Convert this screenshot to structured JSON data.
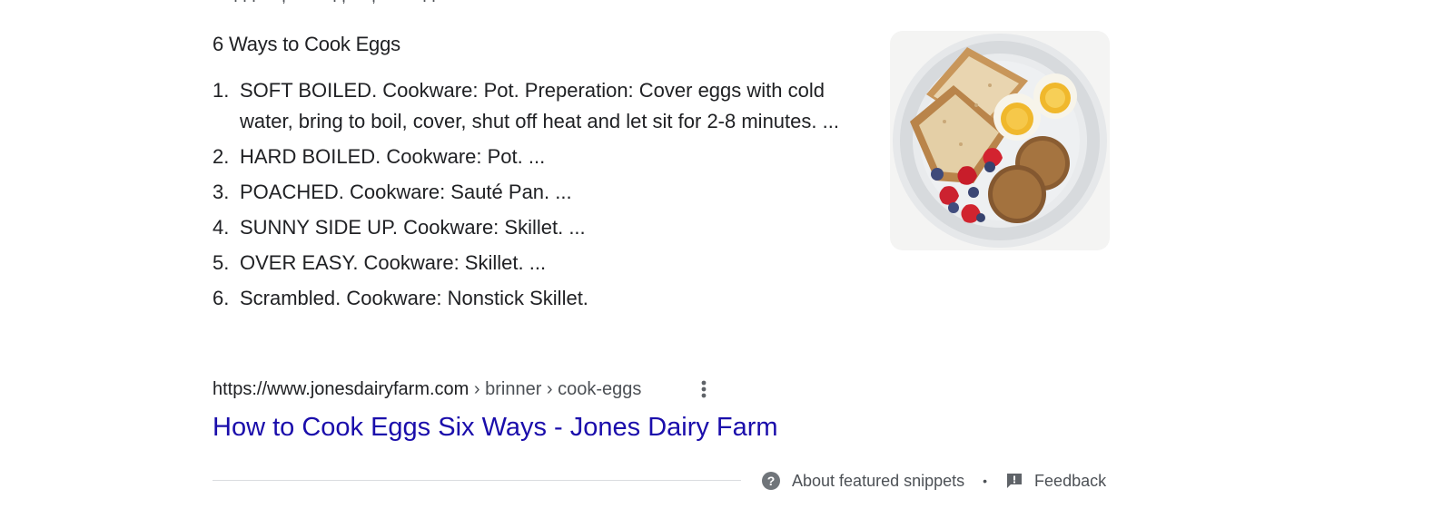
{
  "previous_result": {
    "cutoff_text": "— . . . — , — — . , — , — — . . —"
  },
  "featured_snippet": {
    "title": "6 Ways to Cook Eggs",
    "items": [
      {
        "num": "1.",
        "text": "SOFT BOILED. Cookware: Pot. Preperation: Cover eggs with cold water, bring to boil, cover, shut off heat and let sit for 2-8 minutes. ..."
      },
      {
        "num": "2.",
        "text": "HARD BOILED. Cookware: Pot. ..."
      },
      {
        "num": "3.",
        "text": "POACHED. Cookware: Sauté Pan. ..."
      },
      {
        "num": "4.",
        "text": "SUNNY SIDE UP. Cookware: Skillet. ..."
      },
      {
        "num": "5.",
        "text": "OVER EASY. Cookware: Skillet. ..."
      },
      {
        "num": "6.",
        "text": "Scrambled. Cookware: Nonstick Skillet."
      }
    ],
    "image_icon": "breakfast-plate-photo"
  },
  "source": {
    "domain": "https://www.jonesdairyfarm.com",
    "breadcrumbs": " › brinner › cook-eggs",
    "menu_icon": "more-vert-icon"
  },
  "result": {
    "title": "How to Cook Eggs Six Ways - Jones Dairy Farm",
    "link_color": "#1a0dab"
  },
  "footer": {
    "about_label": "About featured snippets",
    "about_icon": "help-circle-icon",
    "separator": "•",
    "feedback_label": "Feedback",
    "feedback_icon": "feedback-icon"
  }
}
